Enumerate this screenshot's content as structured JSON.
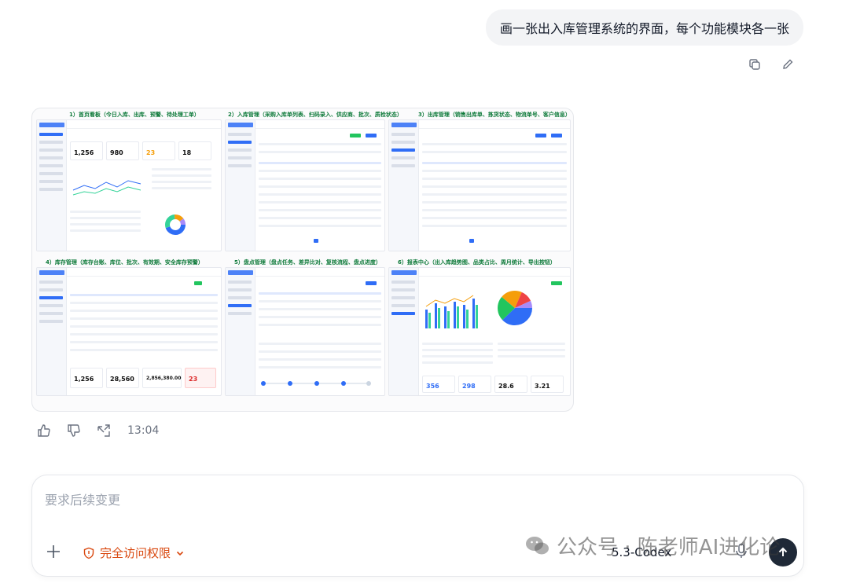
{
  "user_message": "画一张出入库管理系统的界面，每个功能模块各一张",
  "image": {
    "sections": [
      {
        "title": "1）首页看板（今日入库、出库、预警、待处理工单）"
      },
      {
        "title": "2）入库管理（采购入库单列表、扫码录入、供应商、批次、质检状态）"
      },
      {
        "title": "3）出库管理（销售出库单、拣货状态、物流单号、客户信息）"
      },
      {
        "title": "4）库存管理（库存台账、库位、批次、有效期、安全库存预警）"
      },
      {
        "title": "5）盘点管理（盘点任务、差异比对、复核流程、盘点进度）"
      },
      {
        "title": "6）报表中心（出入库趋势图、品类占比、周月统计、导出按钮）"
      }
    ],
    "dashboard_stats": [
      "1,256",
      "980",
      "23",
      "18"
    ],
    "inventory_stats": [
      "1,256",
      "28,560",
      "2,856,380.00",
      "23"
    ],
    "report_stats": [
      "356",
      "298",
      "28.6",
      "3.21"
    ]
  },
  "message_time": "13:04",
  "composer": {
    "placeholder": "要求后续变更",
    "access_label": "完全访问权限",
    "model_label": "5.3-Codex"
  },
  "watermark": "公众号 · 陈老师AI进化论",
  "colors": {
    "accent": "#2f6df6",
    "section_title": "#0e7a3a",
    "access": "#d9480f"
  }
}
